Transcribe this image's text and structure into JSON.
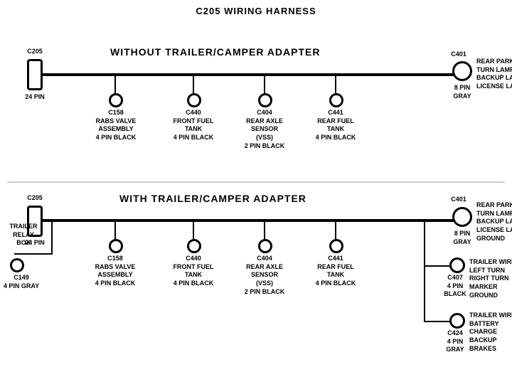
{
  "title": "C205 WIRING HARNESS",
  "section1": {
    "label": "WITHOUT  TRAILER/CAMPER  ADAPTER",
    "left_connector": {
      "id": "C205",
      "sub": "24 PIN"
    },
    "right_connector": {
      "id": "C401",
      "sub": "8 PIN\nGRAY",
      "labels": [
        "REAR PARK/STOP",
        "TURN LAMPS",
        "BACKUP LAMPS",
        "LICENSE LAMPS"
      ]
    },
    "connectors": [
      {
        "id": "C158",
        "label": "RABS VALVE\nASSEMBLY\n4 PIN BLACK"
      },
      {
        "id": "C440",
        "label": "FRONT FUEL\nTANK\n4 PIN BLACK"
      },
      {
        "id": "C404",
        "label": "REAR AXLE\nSENSOR\n(VSS)\n2 PIN BLACK"
      },
      {
        "id": "C441",
        "label": "REAR FUEL\nTANK\n4 PIN BLACK"
      }
    ]
  },
  "section2": {
    "label": "WITH  TRAILER/CAMPER  ADAPTER",
    "left_connector": {
      "id": "C205",
      "sub": "24 PIN"
    },
    "trailer_relay": {
      "label": "TRAILER\nRELAY\nBOX"
    },
    "c149": {
      "id": "C149",
      "sub": "4 PIN GRAY"
    },
    "right_connector": {
      "id": "C401",
      "sub": "8 PIN\nGRAY",
      "labels": [
        "REAR PARK/STOP",
        "TURN LAMPS",
        "BACKUP LAMPS",
        "LICENSE LAMPS",
        "GROUND"
      ]
    },
    "c407": {
      "id": "C407",
      "sub": "4 PIN\nBLACK",
      "labels": [
        "TRAILER WIRES",
        "LEFT TURN",
        "RIGHT TURN",
        "MARKER",
        "GROUND"
      ]
    },
    "c424": {
      "id": "C424",
      "sub": "4 PIN\nGRAY",
      "labels": [
        "TRAILER WIRES",
        "BATTERY CHARGE",
        "BACKUP",
        "BRAKES"
      ]
    },
    "connectors": [
      {
        "id": "C158",
        "label": "RABS VALVE\nASSEMBLY\n4 PIN BLACK"
      },
      {
        "id": "C440",
        "label": "FRONT FUEL\nTANK\n4 PIN BLACK"
      },
      {
        "id": "C404",
        "label": "REAR AXLE\nSENSOR\n(VSS)\n2 PIN BLACK"
      },
      {
        "id": "C441",
        "label": "REAR FUEL\nTANK\n4 PIN BLACK"
      }
    ]
  }
}
